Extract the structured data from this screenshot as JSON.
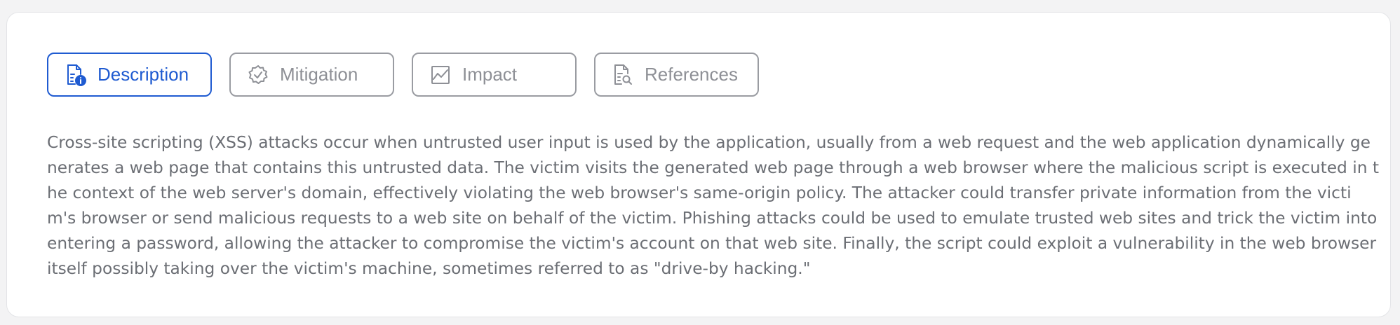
{
  "tabs": [
    {
      "label": "Description",
      "icon": "document-info-icon",
      "active": true
    },
    {
      "label": "Mitigation",
      "icon": "badge-check-icon",
      "active": false
    },
    {
      "label": "Impact",
      "icon": "chart-line-icon",
      "active": false
    },
    {
      "label": "References",
      "icon": "document-search-icon",
      "active": false
    }
  ],
  "colors": {
    "active": "#1f5bd1",
    "inactive": "#8e9096",
    "text": "#6b6e74"
  },
  "description": "Cross-site scripting (XSS) attacks occur when untrusted user input is used by the application, usually from a web request and the web application dynamically generates a web page that contains this untrusted data. The victim visits the generated web page through a web browser where the malicious script is executed in the context of the web server's domain, effectively violating the web browser's same-origin policy. The attacker could transfer private information from the victim's browser or send malicious requests to a web site on behalf of the victim. Phishing attacks could be used to emulate trusted web sites and trick the victim into entering a password, allowing the attacker to compromise the victim's account on that web site. Finally, the script could exploit a vulnerability in the web browser itself possibly taking over the victim's machine, sometimes referred to as \"drive-by hacking.\""
}
